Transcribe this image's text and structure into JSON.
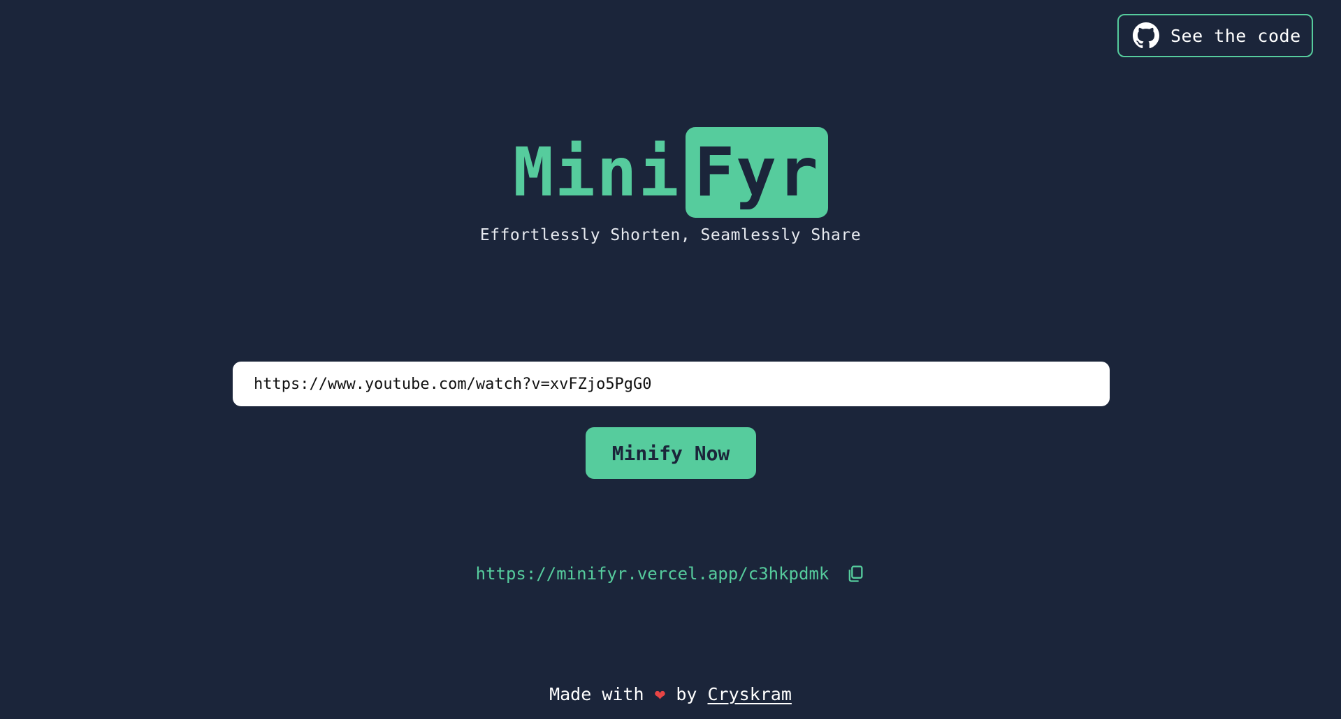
{
  "header": {
    "github_button": {
      "label": "See the code",
      "icon": "github-icon"
    }
  },
  "logo": {
    "part1": "Mini",
    "part2": "Fyr"
  },
  "tagline": "Effortlessly Shorten, Seamlessly Share",
  "form": {
    "url_value": "https://www.youtube.com/watch?v=xvFZjo5PgG0",
    "submit_label": "Minify Now"
  },
  "result": {
    "short_url": "https://minifyr.vercel.app/c3hkpdmk",
    "copy_icon": "copy-icon"
  },
  "footer": {
    "prefix": "Made with",
    "heart_icon": "heart-icon",
    "by": "by",
    "author": "Cryskram"
  },
  "colors": {
    "background": "#1b253a",
    "accent": "#56cc9d",
    "heart": "#e84545"
  }
}
